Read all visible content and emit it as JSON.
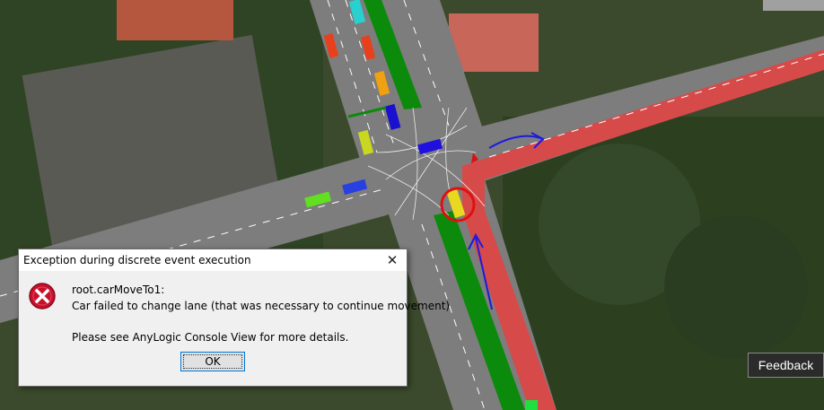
{
  "dialog": {
    "title": "Exception during discrete event execution",
    "close_glyph": "✕",
    "icon": "error-icon",
    "line1": "root.carMoveTo1:",
    "line2": "Car failed to change lane (that was necessary to continue movement)",
    "line3": "Please see AnyLogic Console View for more details.",
    "ok_label": "OK"
  },
  "feedback": {
    "label": "Feedback"
  },
  "colors": {
    "road": "#7a7a7a",
    "lane_green": "#0a8a0a",
    "highlight_red": "#d84a4a",
    "annotation_blue": "#1a1ae0",
    "error_red": "#c8102e"
  }
}
